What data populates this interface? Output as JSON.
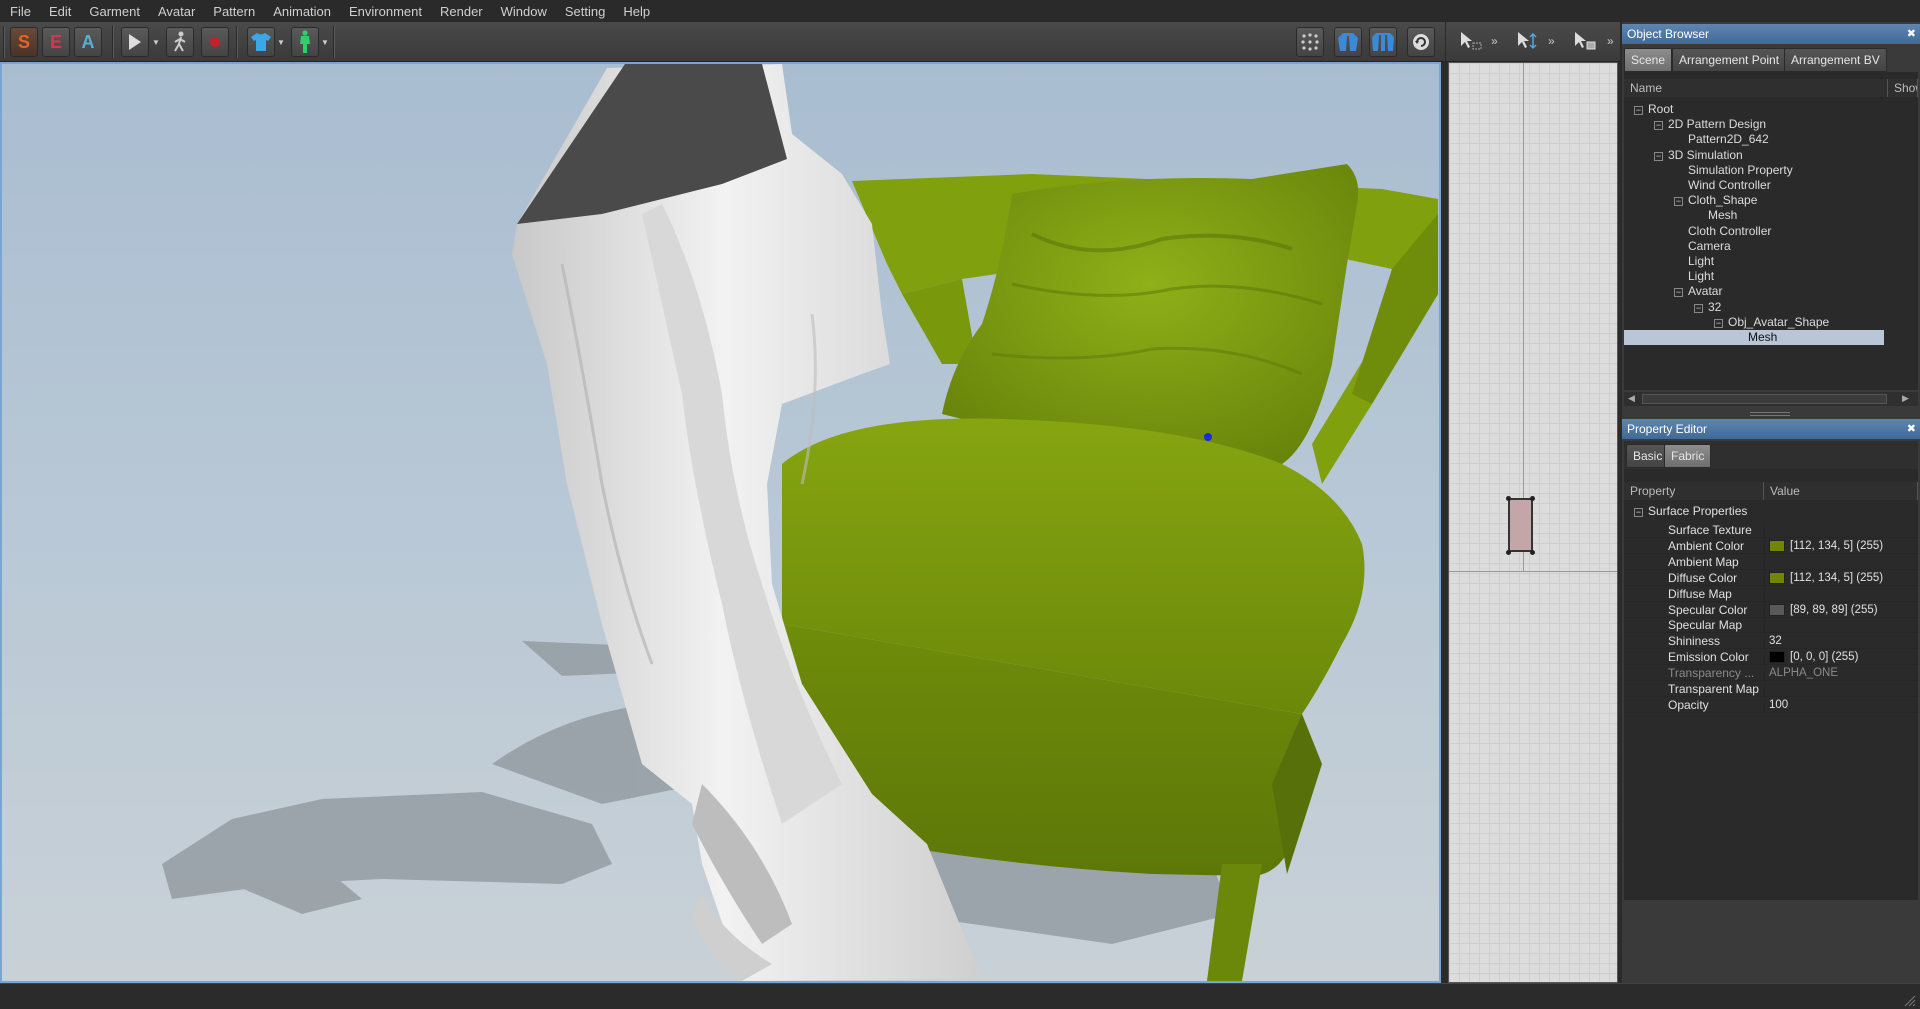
{
  "menu": [
    "File",
    "Edit",
    "Garment",
    "Avatar",
    "Pattern",
    "Animation",
    "Environment",
    "Render",
    "Window",
    "Setting",
    "Help"
  ],
  "toolbar": {
    "s_label": "S",
    "e_label": "E",
    "a_label": "A"
  },
  "colors": {
    "chair": "#7a980c",
    "chair_dark": "#5a7008",
    "cloth": "#e6e6e6",
    "cloth_shadow": "#b9b9b9",
    "hem_dark": "#4a4a4a",
    "accent_s": "#e0662a",
    "accent_e": "#d8364f",
    "accent_a": "#58b0d6"
  },
  "object_browser": {
    "title": "Object Browser",
    "tabs": [
      "Scene",
      "Arrangement Point",
      "Arrangement BV"
    ],
    "col_name": "Name",
    "col_show": "Show",
    "tree": [
      {
        "label": "Root",
        "depth": 0,
        "toggle": "−"
      },
      {
        "label": "2D Pattern Design",
        "depth": 1,
        "toggle": "−"
      },
      {
        "label": "Pattern2D_642",
        "depth": 2,
        "toggle": ""
      },
      {
        "label": "3D Simulation",
        "depth": 1,
        "toggle": "−"
      },
      {
        "label": "Simulation Property",
        "depth": 2,
        "toggle": ""
      },
      {
        "label": "Wind Controller",
        "depth": 2,
        "toggle": ""
      },
      {
        "label": "Cloth_Shape",
        "depth": 2,
        "toggle": "−"
      },
      {
        "label": "Mesh",
        "depth": 3,
        "toggle": ""
      },
      {
        "label": "Cloth Controller",
        "depth": 2,
        "toggle": ""
      },
      {
        "label": "Camera",
        "depth": 2,
        "toggle": ""
      },
      {
        "label": "Light",
        "depth": 2,
        "toggle": ""
      },
      {
        "label": "Light",
        "depth": 2,
        "toggle": ""
      },
      {
        "label": "Avatar",
        "depth": 2,
        "toggle": "−"
      },
      {
        "label": "32",
        "depth": 3,
        "toggle": "−"
      },
      {
        "label": "Obj_Avatar_Shape",
        "depth": 4,
        "toggle": "−"
      },
      {
        "label": "Mesh",
        "depth": 5,
        "toggle": "",
        "selected": true
      }
    ]
  },
  "property_editor": {
    "title": "Property Editor",
    "tabs": [
      "Basic",
      "Fabric"
    ],
    "col_property": "Property",
    "col_value": "Value",
    "group": "Surface Properties",
    "rows": [
      {
        "name": "Surface Texture",
        "value": "",
        "swatch": ""
      },
      {
        "name": "Ambient Color",
        "value": "[112, 134, 5] (255)",
        "swatch": "#708605"
      },
      {
        "name": "Ambient Map",
        "value": "",
        "swatch": ""
      },
      {
        "name": "Diffuse Color",
        "value": "[112, 134, 5] (255)",
        "swatch": "#708605"
      },
      {
        "name": "Diffuse Map",
        "value": "",
        "swatch": ""
      },
      {
        "name": "Specular Color",
        "value": "[89, 89, 89] (255)",
        "swatch": "#595959"
      },
      {
        "name": "Specular Map",
        "value": "",
        "swatch": ""
      },
      {
        "name": "Shininess",
        "value": "32",
        "swatch": ""
      },
      {
        "name": "Emission Color",
        "value": "[0, 0, 0] (255)",
        "swatch": "#000000"
      },
      {
        "name": "Transparency ...",
        "value": "ALPHA_ONE",
        "swatch": "",
        "dim": true
      },
      {
        "name": "Transparent Map",
        "value": "",
        "swatch": ""
      },
      {
        "name": "Opacity",
        "value": "100",
        "swatch": ""
      }
    ]
  }
}
